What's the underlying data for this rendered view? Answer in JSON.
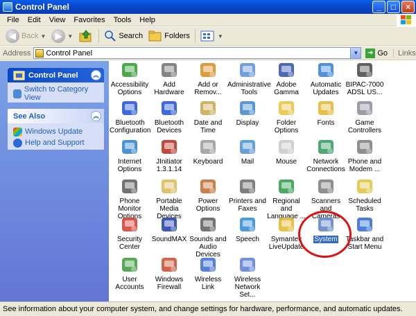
{
  "window": {
    "title": "Control Panel"
  },
  "menu": [
    "File",
    "Edit",
    "View",
    "Favorites",
    "Tools",
    "Help"
  ],
  "toolbar": {
    "back": "Back",
    "search": "Search",
    "folders": "Folders"
  },
  "address": {
    "label": "Address",
    "value": "Control Panel",
    "go": "Go",
    "links": "Links"
  },
  "sidebar": {
    "panel_title": "Control Panel",
    "switch_link": "Switch to Category View",
    "see_also_title": "See Also",
    "see_also": [
      "Windows Update",
      "Help and Support"
    ]
  },
  "items": [
    {
      "label": "Accessibility Options",
      "icon": "accessibility-icon",
      "color": "#2c9a2c"
    },
    {
      "label": "Add Hardware",
      "icon": "add-hardware-icon",
      "color": "#6e6e6e"
    },
    {
      "label": "Add or Remov...",
      "icon": "add-remove-programs-icon",
      "color": "#d98b1c"
    },
    {
      "label": "Administrative Tools",
      "icon": "administrative-tools-icon",
      "color": "#5a8fd6"
    },
    {
      "label": "Adobe Gamma",
      "icon": "adobe-gamma-icon",
      "color": "#2d4fa8"
    },
    {
      "label": "Automatic Updates",
      "icon": "automatic-updates-icon",
      "color": "#2f7fd9"
    },
    {
      "label": "BIPAC-7000 ADSL US...",
      "icon": "bipac-icon",
      "color": "#444444"
    },
    {
      "label": "Bluetooth Configuration",
      "icon": "bluetooth-icon",
      "color": "#1c4fd6"
    },
    {
      "label": "Bluetooth Devices",
      "icon": "bluetooth-icon",
      "color": "#1c4fd6"
    },
    {
      "label": "Date and Time",
      "icon": "date-time-icon",
      "color": "#c9a64a"
    },
    {
      "label": "Display",
      "icon": "display-icon",
      "color": "#3c86c9"
    },
    {
      "label": "Folder Options",
      "icon": "folder-options-icon",
      "color": "#e8c23a"
    },
    {
      "label": "Fonts",
      "icon": "fonts-icon",
      "color": "#e3b528"
    },
    {
      "label": "Game Controllers",
      "icon": "game-controllers-icon",
      "color": "#8a8a9a"
    },
    {
      "label": "Internet Options",
      "icon": "internet-options-icon",
      "color": "#2a7fc8"
    },
    {
      "label": "JInitiator 1.3.1.14",
      "icon": "jinitiator-icon",
      "color": "#b52a1f"
    },
    {
      "label": "Keyboard",
      "icon": "keyboard-icon",
      "color": "#9a9a9a"
    },
    {
      "label": "Mail",
      "icon": "mail-icon",
      "color": "#4a8fd0"
    },
    {
      "label": "Mouse",
      "icon": "mouse-icon",
      "color": "#c8c8c8"
    },
    {
      "label": "Network Connections",
      "icon": "network-connections-icon",
      "color": "#2c9a5a"
    },
    {
      "label": "Phone and Modem ...",
      "icon": "phone-modem-icon",
      "color": "#7a7a7a"
    },
    {
      "label": "Phone Monitor Options",
      "icon": "phone-monitor-icon",
      "color": "#5a5a5a"
    },
    {
      "label": "Portable Media Devices",
      "icon": "portable-media-icon",
      "color": "#d8b850"
    },
    {
      "label": "Power Options",
      "icon": "power-options-icon",
      "color": "#c06a2a"
    },
    {
      "label": "Printers and Faxes",
      "icon": "printers-faxes-icon",
      "color": "#6a6a6a"
    },
    {
      "label": "Regional and Language ...",
      "icon": "regional-language-icon",
      "color": "#2a9a4a"
    },
    {
      "label": "Scanners and Cameras",
      "icon": "scanners-cameras-icon",
      "color": "#7a7a7a"
    },
    {
      "label": "Scheduled Tasks",
      "icon": "scheduled-tasks-icon",
      "color": "#e0c23a"
    },
    {
      "label": "Security Center",
      "icon": "security-center-icon",
      "color": "#d23a2a"
    },
    {
      "label": "SoundMAX",
      "icon": "soundmax-icon",
      "color": "#1a3aa8"
    },
    {
      "label": "Sounds and Audio Devices",
      "icon": "sounds-audio-icon",
      "color": "#5a5a5a"
    },
    {
      "label": "Speech",
      "icon": "speech-icon",
      "color": "#2a8ad6"
    },
    {
      "label": "Symantec LiveUpdate",
      "icon": "symantec-liveupdate-icon",
      "color": "#e0b828"
    },
    {
      "label": "System",
      "icon": "system-icon",
      "color": "#5b7fc8"
    },
    {
      "label": "Taskbar and Start Menu",
      "icon": "taskbar-start-menu-icon",
      "color": "#2a6ad6"
    },
    {
      "label": "User Accounts",
      "icon": "user-accounts-icon",
      "color": "#3a9a3a"
    },
    {
      "label": "Windows Firewall",
      "icon": "windows-firewall-icon",
      "color": "#c84a2a"
    },
    {
      "label": "Wireless Link",
      "icon": "wireless-link-icon",
      "color": "#3a6ad6"
    },
    {
      "label": "Wireless Network Set...",
      "icon": "wireless-network-icon",
      "color": "#5a7ad6"
    }
  ],
  "selected_item": "System",
  "status": "See information about your computer system, and change settings for hardware, performance, and automatic updates."
}
